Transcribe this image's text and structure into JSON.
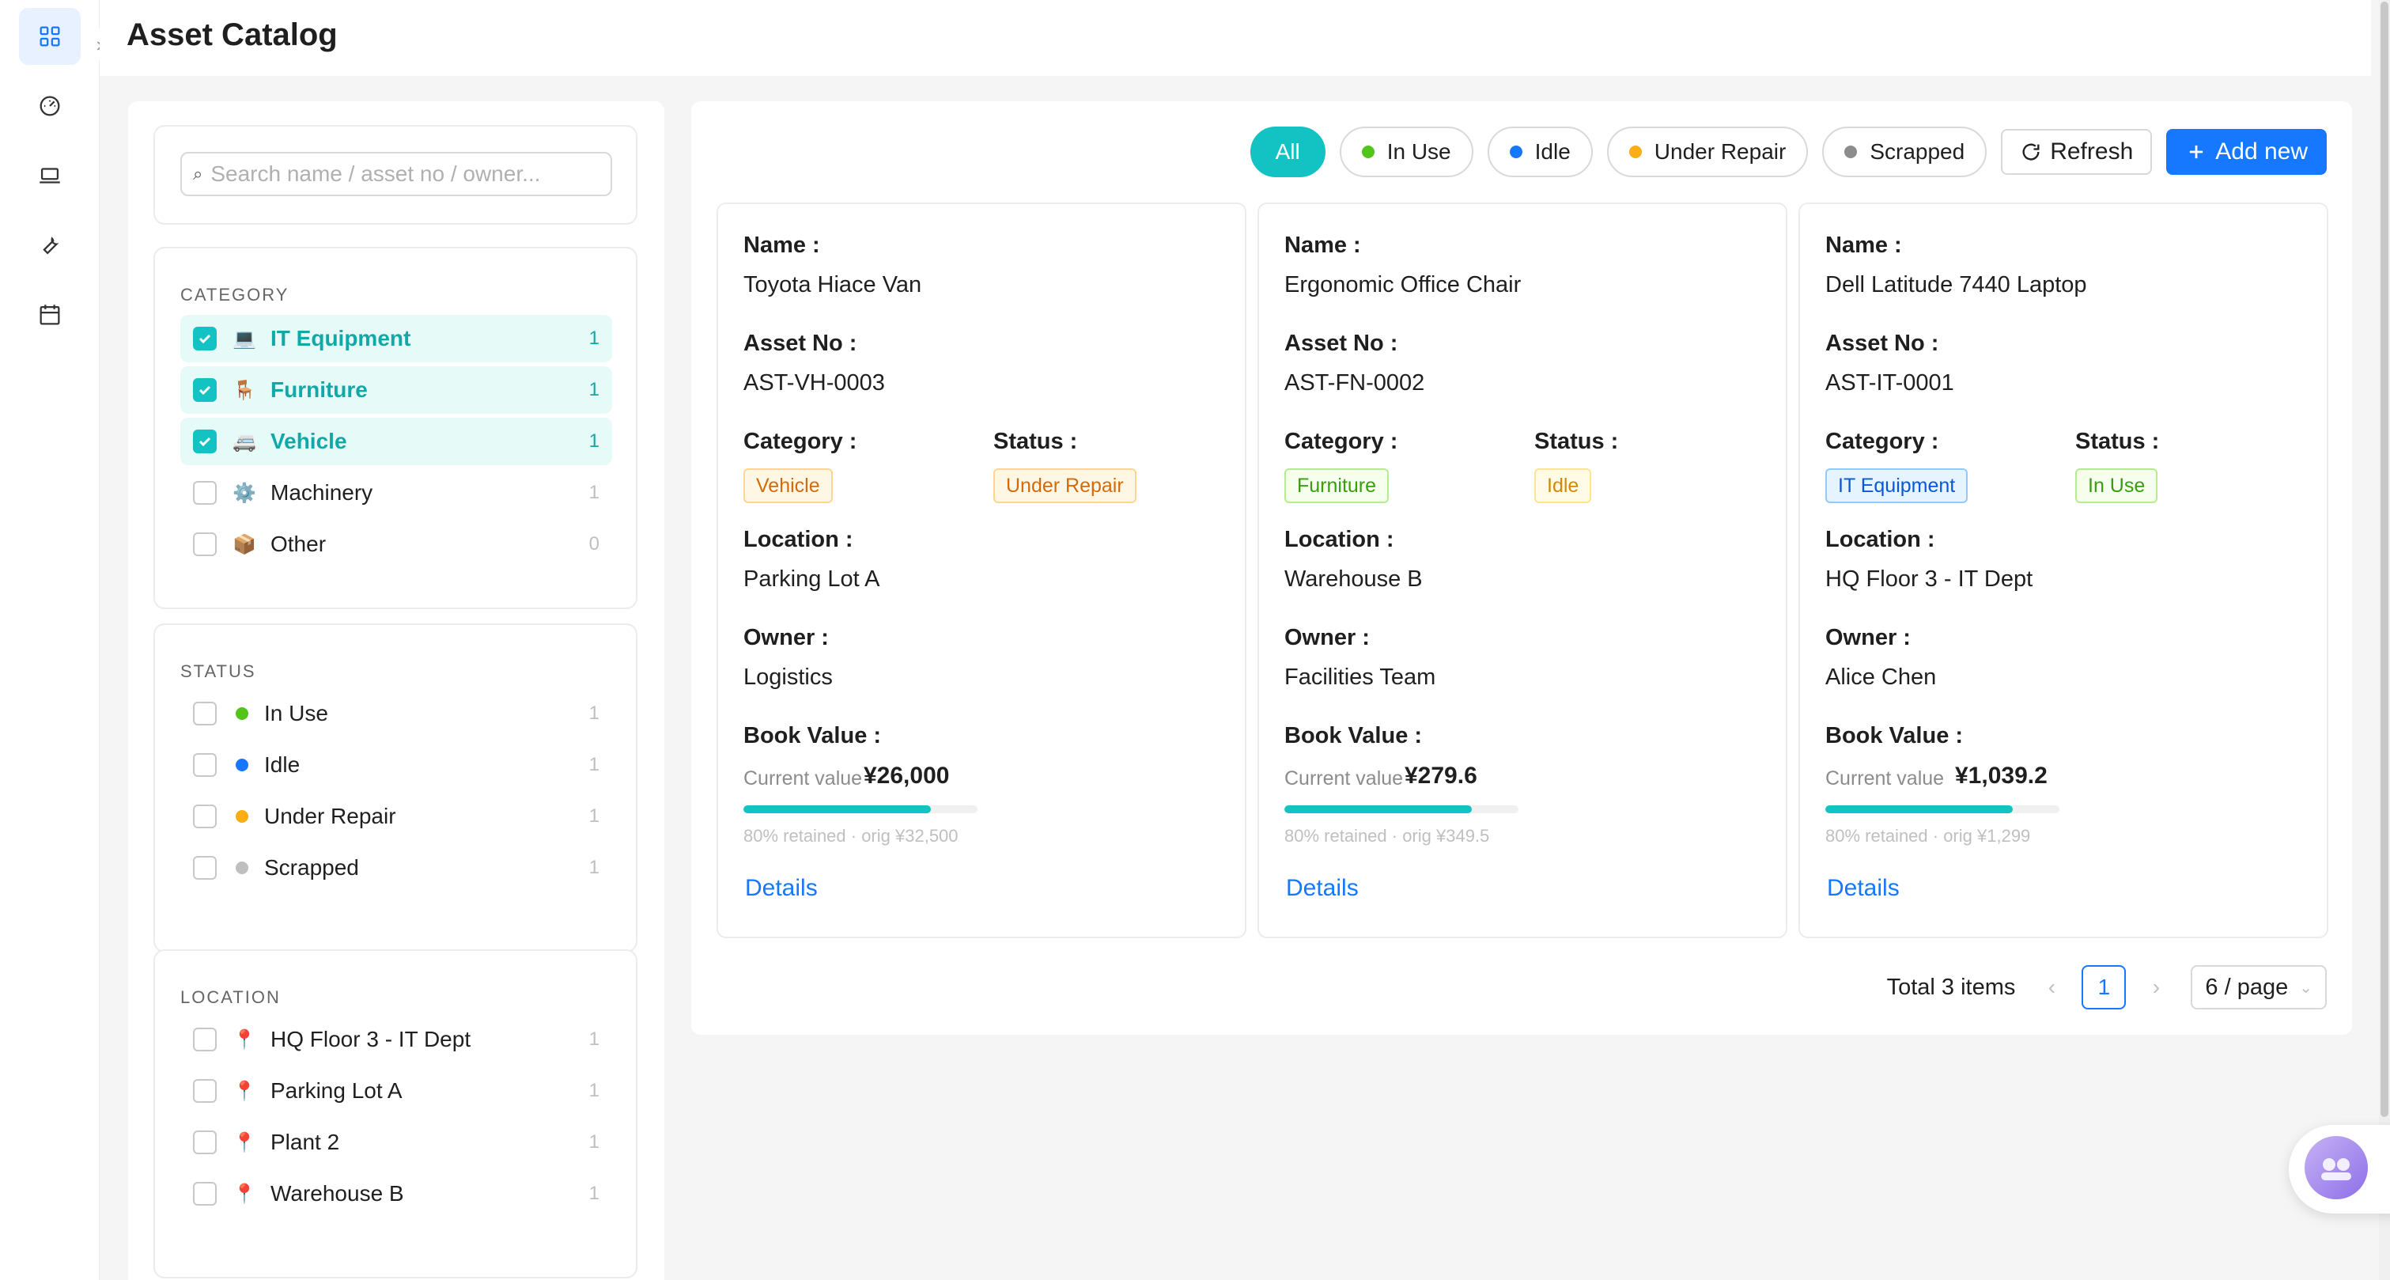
{
  "app": {
    "title": "Asset Catalog"
  },
  "rail": [
    "dashboard-grid-icon",
    "gauge-icon",
    "laptop-icon",
    "wrench-icon",
    "calendar-icon"
  ],
  "search": {
    "placeholder": "Search name / asset no / owner...",
    "value": ""
  },
  "filters": {
    "category": {
      "title": "CATEGORY",
      "items": [
        {
          "label": "IT Equipment",
          "icon": "💻",
          "count": "1",
          "checked": true
        },
        {
          "label": "Furniture",
          "icon": "🪑",
          "count": "1",
          "checked": true
        },
        {
          "label": "Vehicle",
          "icon": "🚐",
          "count": "1",
          "checked": true
        },
        {
          "label": "Machinery",
          "icon": "⚙️",
          "count": "1",
          "checked": false
        },
        {
          "label": "Other",
          "icon": "📦",
          "count": "0",
          "checked": false
        }
      ]
    },
    "status": {
      "title": "STATUS",
      "items": [
        {
          "label": "In Use",
          "color": "#52c41a",
          "count": "1"
        },
        {
          "label": "Idle",
          "color": "#1677ff",
          "count": "1"
        },
        {
          "label": "Under Repair",
          "color": "#faad14",
          "count": "1"
        },
        {
          "label": "Scrapped",
          "color": "#bfbfbf",
          "count": "1"
        }
      ]
    },
    "location": {
      "title": "LOCATION",
      "items": [
        {
          "label": "HQ Floor 3 - IT Dept",
          "icon": "📍",
          "count": "1"
        },
        {
          "label": "Parking Lot A",
          "icon": "📍",
          "count": "1"
        },
        {
          "label": "Plant 2",
          "icon": "📍",
          "count": "1"
        },
        {
          "label": "Warehouse B",
          "icon": "📍",
          "count": "1"
        }
      ]
    }
  },
  "toolbar": {
    "pills": [
      {
        "label": "All",
        "active": true
      },
      {
        "label": "In Use",
        "color": "#52c41a"
      },
      {
        "label": "Idle",
        "color": "#1677ff"
      },
      {
        "label": "Under Repair",
        "color": "#faad14"
      },
      {
        "label": "Scrapped",
        "color": "#8c8c8c"
      }
    ],
    "refresh_label": "Refresh",
    "add_label": "Add new"
  },
  "labels": {
    "name": "Name :",
    "asset_no": "Asset No :",
    "category": "Category :",
    "status": "Status :",
    "location": "Location :",
    "owner": "Owner :",
    "book_value": "Book Value :",
    "current_value": "Current value",
    "details": "Details"
  },
  "cards": [
    {
      "name": "Toyota Hiace Van",
      "asset_no": "AST-VH-0003",
      "category": "Vehicle",
      "category_style": {
        "color": "#d46b08",
        "bg": "#fff7e6",
        "border": "#ffd591"
      },
      "status": "Under Repair",
      "status_style": {
        "color": "#d46b08",
        "bg": "#fff7e6",
        "border": "#ffd591"
      },
      "location": "Parking Lot A",
      "owner": "Logistics",
      "current_value": "¥26,000",
      "retained_fraction": 0.8,
      "retained_text": "80% retained · orig ¥32,500"
    },
    {
      "name": "Ergonomic Office Chair",
      "asset_no": "AST-FN-0002",
      "category": "Furniture",
      "category_style": {
        "color": "#389e0d",
        "bg": "#f6ffed",
        "border": "#b7eb8f"
      },
      "status": "Idle",
      "status_style": {
        "color": "#d48806",
        "bg": "#fffbe6",
        "border": "#ffe58f"
      },
      "location": "Warehouse B",
      "owner": "Facilities Team",
      "current_value": "¥279.6",
      "retained_fraction": 0.8,
      "retained_text": "80% retained · orig ¥349.5"
    },
    {
      "name": "Dell Latitude 7440 Laptop",
      "asset_no": "AST-IT-0001",
      "category": "IT Equipment",
      "category_style": {
        "color": "#0958d9",
        "bg": "#e6f4ff",
        "border": "#91caff"
      },
      "status": "In Use",
      "status_style": {
        "color": "#389e0d",
        "bg": "#f6ffed",
        "border": "#b7eb8f"
      },
      "location": "HQ Floor 3 - IT Dept",
      "owner": "Alice Chen",
      "current_value": "¥1,039.2",
      "retained_fraction": 0.8,
      "retained_text": "80% retained · orig ¥1,299"
    }
  ],
  "pagination": {
    "total": "Total 3 items",
    "page": "1",
    "page_size": "6 / page"
  },
  "colors": {
    "accent": "#13c2c2",
    "primary": "#1677ff"
  }
}
